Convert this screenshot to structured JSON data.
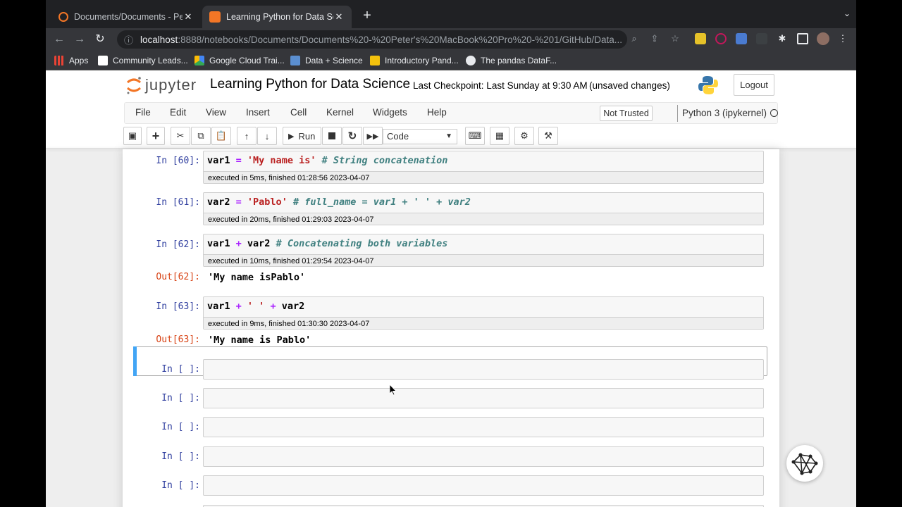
{
  "browser": {
    "tabs": [
      {
        "title": "Documents/Documents - Peter's",
        "active": false
      },
      {
        "title": "Learning Python for Data Science",
        "active": true
      }
    ],
    "url_host": "localhost",
    "url_path": ":8888/notebooks/Documents/Documents%20-%20Peter's%20MacBook%20Pro%20-%201/GitHub/Data...",
    "bookmarks": [
      "Apps",
      "Community Leads...",
      "Google Cloud Trai...",
      "Data + Science",
      "Introductory Pand...",
      "The pandas DataF..."
    ]
  },
  "header": {
    "logo_text": "jupyter",
    "notebook_title": "Learning Python for Data Science",
    "checkpoint": "Last Checkpoint: Last Sunday at 9:30 AM",
    "unsaved": "(unsaved changes)",
    "logout": "Logout"
  },
  "menubar": {
    "items": [
      "File",
      "Edit",
      "View",
      "Insert",
      "Cell",
      "Kernel",
      "Widgets",
      "Help"
    ],
    "trusted": "Not Trusted",
    "kernel": "Python 3 (ipykernel)"
  },
  "toolbar": {
    "run_label": "Run",
    "cell_type": "Code"
  },
  "cells": [
    {
      "prompt": "In [60]:",
      "exec": "executed in 5ms, finished 01:28:56 2023-04-07"
    },
    {
      "prompt": "In [61]:",
      "exec": "executed in 20ms, finished 01:29:03 2023-04-07"
    },
    {
      "prompt": "In [62]:",
      "exec": "executed in 10ms, finished 01:29:54 2023-04-07",
      "out_prompt": "Out[62]:",
      "output": "'My name isPablo'"
    },
    {
      "prompt": "In [63]:",
      "exec": "executed in 9ms, finished 01:30:30 2023-04-07",
      "out_prompt": "Out[63]:",
      "output": "'My name is Pablo'"
    }
  ],
  "empty_prompt": "In [ ]:",
  "colors": {
    "accent": "#42a5f5",
    "in_prompt": "#303f9f",
    "out_prompt": "#d84315"
  }
}
